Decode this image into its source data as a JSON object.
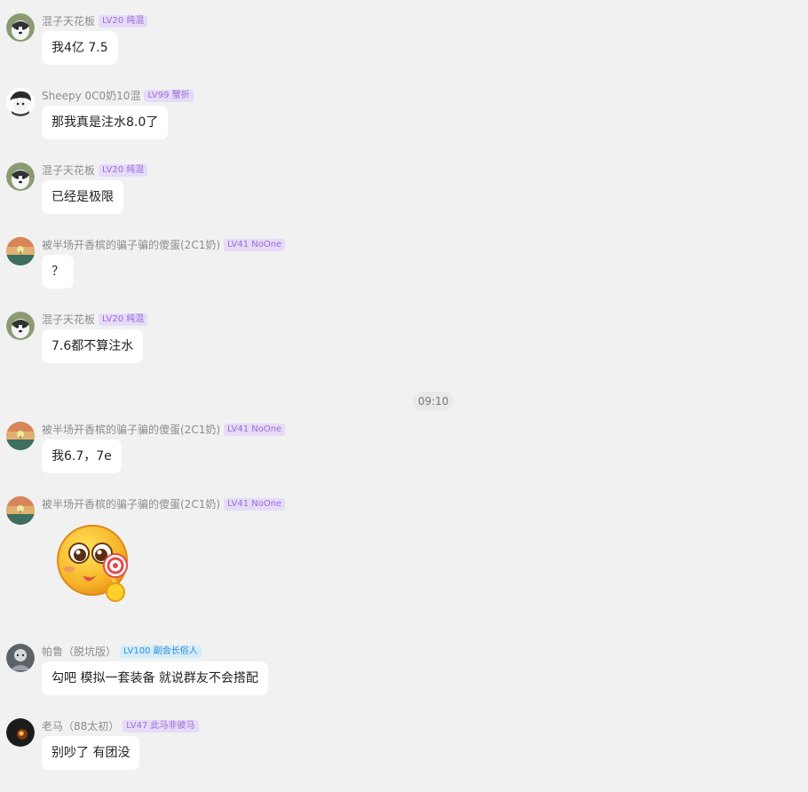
{
  "time_divider": "09:10",
  "messages": [
    {
      "name": "混子天花板",
      "badge": "LV20 纯混",
      "text": "我4亿 7.5",
      "avatar": "husky-avatar"
    },
    {
      "name": "Sheepy 0C0奶10混",
      "badge": "LV99 蟹折",
      "text": "那我真是注水8.0了",
      "avatar": "sheep-avatar"
    },
    {
      "name": "混子天花板",
      "badge": "LV20 纯混",
      "text": "已经是极限",
      "avatar": "husky-avatar"
    },
    {
      "name": "被半场开香槟的骗子骗的傻蛋(2C1奶)",
      "badge": "LV41 NoOne",
      "text": "？",
      "avatar": "sunset-avatar"
    },
    {
      "name": "混子天花板",
      "badge": "LV20 纯混",
      "text": "7.6都不算注水",
      "avatar": "husky-avatar"
    },
    {
      "name": "被半场开香槟的骗子骗的傻蛋(2C1奶)",
      "badge": "LV41 NoOne",
      "text": "我6.7，7e",
      "avatar": "sunset-avatar"
    },
    {
      "name": "被半场开香槟的骗子骗的傻蛋(2C1奶)",
      "badge": "LV41 NoOne",
      "sticker": "lollipop-emoji-sticker",
      "avatar": "sunset-avatar"
    },
    {
      "name": "帕鲁（脱坑版）",
      "badge": "LV100 副会长俗人",
      "text": "勾吧 模拟一套装备  就说群友不会搭配",
      "avatar": "gray-avatar"
    },
    {
      "name": "老马（88太初）",
      "badge": "LV47 此马非彼马",
      "text": "别吵了 有团没",
      "avatar": "dark-avatar"
    }
  ]
}
